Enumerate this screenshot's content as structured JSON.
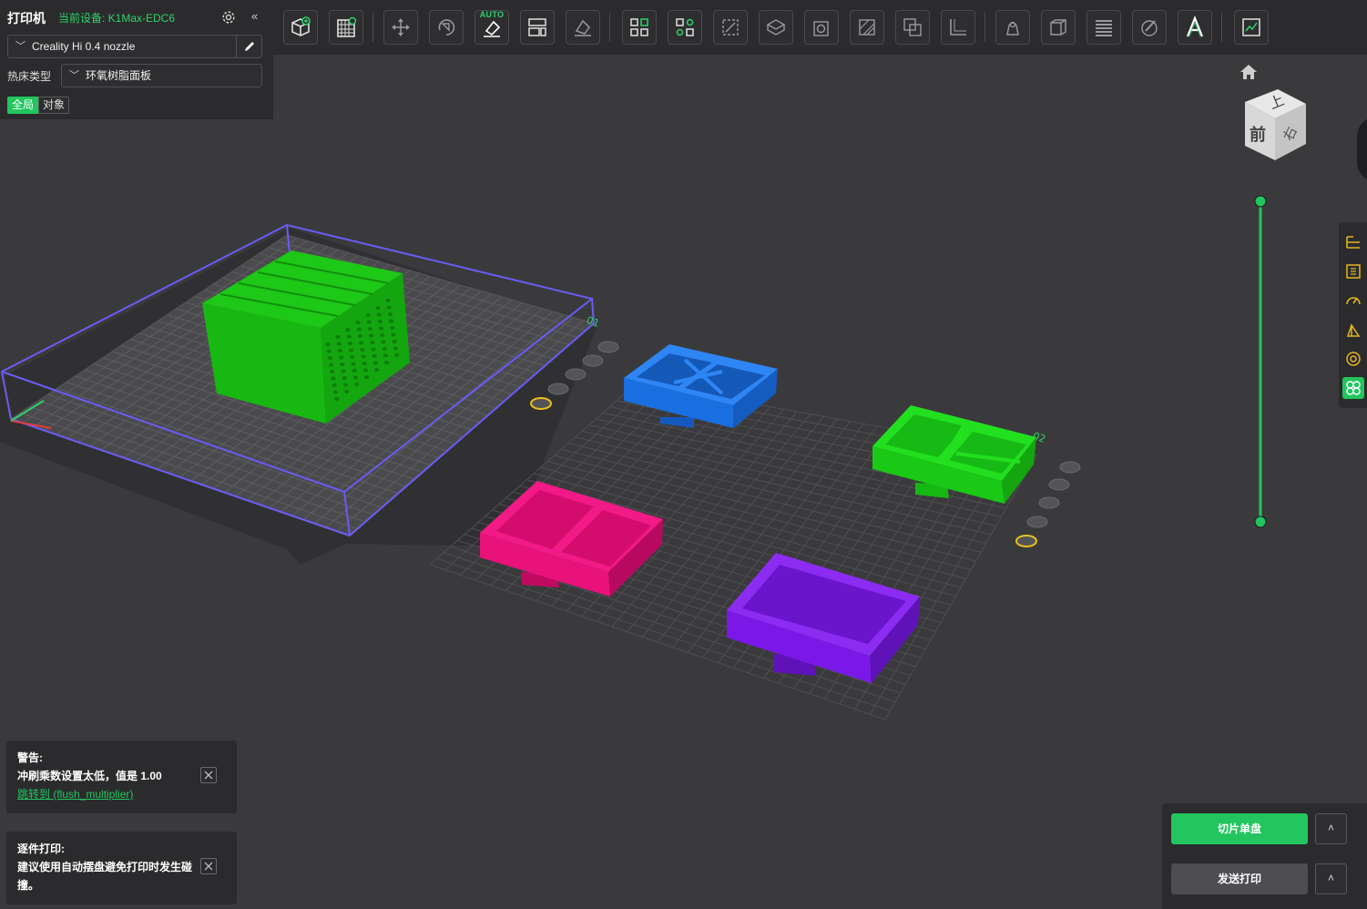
{
  "printer": {
    "title": "打印机",
    "current_device": "当前设备: K1Max-EDC6",
    "nozzle": "Creality Hi 0.4 nozzle",
    "bed_type_label": "热床类型",
    "bed_type": "环氧树脂面板",
    "scope_global": "全局",
    "scope_object": "对象"
  },
  "toolbar": {
    "auto_badge": "AUTO",
    "items": [
      "add-object",
      "arrange-grid",
      "move",
      "rotate",
      "auto-orient",
      "layout",
      "lay-flat",
      "arrange",
      "arrange-settings",
      "scale",
      "cut",
      "hollow",
      "paint-support",
      "boolean",
      "measure",
      "seam",
      "mmu",
      "variable-layer",
      "paint",
      "text",
      "assembly"
    ]
  },
  "nav_cube": {
    "top": "上",
    "front": "前",
    "right": "右"
  },
  "plates": [
    {
      "label": "01"
    },
    {
      "label": "02"
    }
  ],
  "notifications": [
    {
      "title": "警告:",
      "message": "冲刷乘数设置太低，值是 1.00",
      "link": "跳转到 (flush_multiplier)"
    },
    {
      "title": "逐件打印:",
      "message": "建议使用自动摆盘避免打印时发生碰撞。"
    }
  ],
  "actions": {
    "slice": "切片单盘",
    "send": "发送打印",
    "caret": "˄"
  },
  "colors": {
    "accent": "#22c55e",
    "panel": "#2b2b2d",
    "viewport": "#3a3a3c",
    "bbox": "#6a5cf5",
    "model_green": "#22d618",
    "model_blue": "#1a6fe0",
    "model_pink": "#e8127a",
    "model_purple": "#7b18e8"
  }
}
